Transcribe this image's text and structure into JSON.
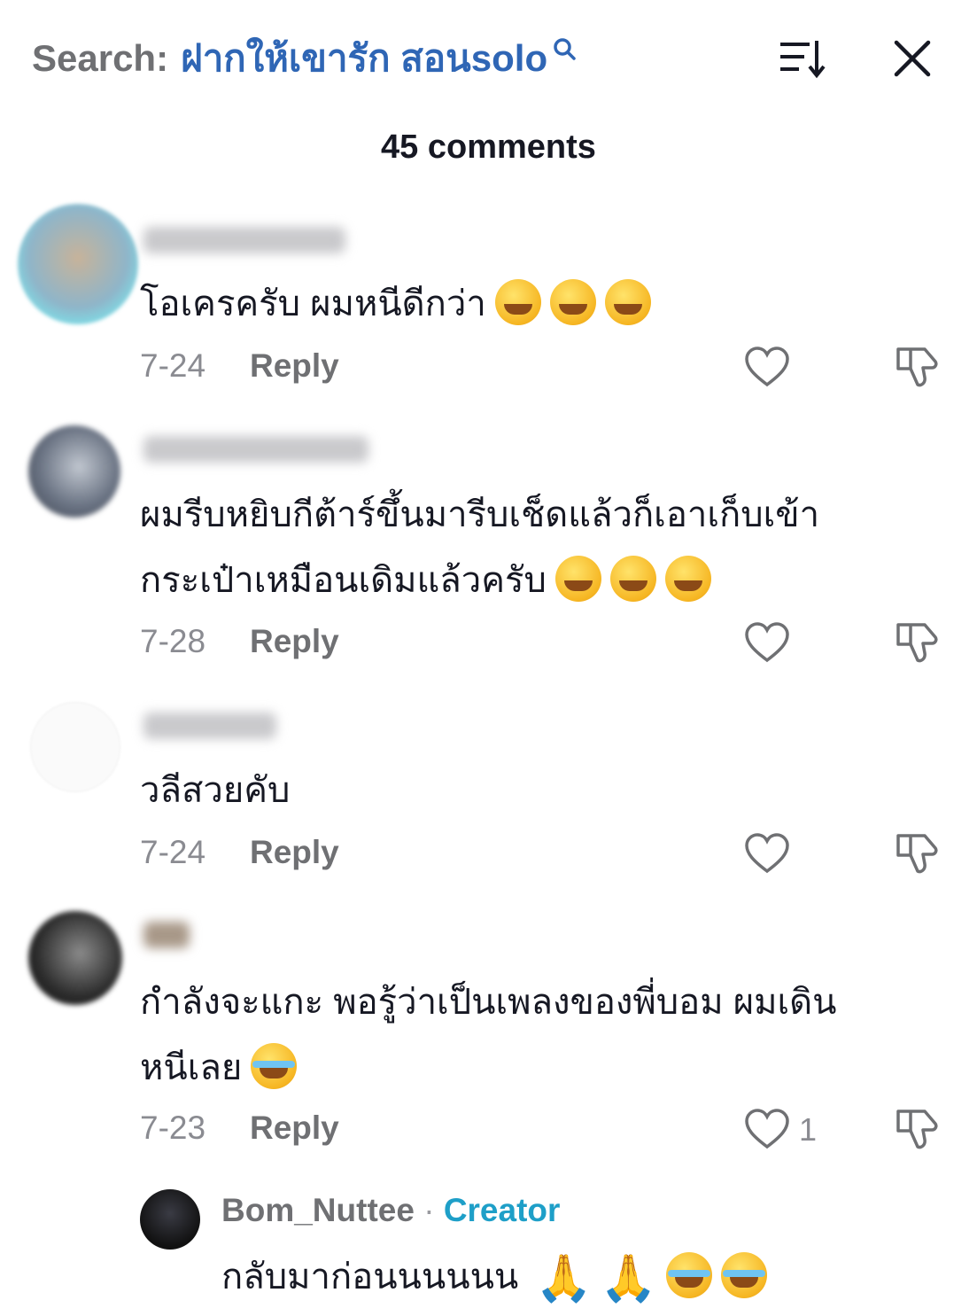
{
  "header": {
    "search_prefix": "Search:",
    "search_query": "ฝากให้เขารัก สอนsolo",
    "comment_count": "45 comments"
  },
  "comments": [
    {
      "text_line1": "โอเครครับ ผมหนีดีกว่า",
      "emojis": [
        "laughing-face",
        "laughing-face",
        "laughing-face"
      ],
      "date": "7-24",
      "reply_label": "Reply"
    },
    {
      "text_line1": "ผมรีบหยิบกีต้าร์ขึ้นมารีบเช็ดแล้วก็เอาเก็บเข้า",
      "text_line2": "กระเป๋าเหมือนเดิมแล้วครับ",
      "emojis": [
        "grinning-face",
        "grinning-face",
        "grinning-face"
      ],
      "date": "7-28",
      "reply_label": "Reply"
    },
    {
      "text_line1": "วลีสวยคับ",
      "date": "7-24",
      "reply_label": "Reply"
    },
    {
      "text_line1": "กำลังจะแกะ พอรู้ว่าเป็นเพลงของพี่บอม ผมเดิน",
      "text_line2": "หนีเลย",
      "emojis": [
        "tears-of-joy-face"
      ],
      "date": "7-23",
      "reply_label": "Reply",
      "like_count": "1"
    }
  ],
  "creator_reply": {
    "username": "Bom_Nuttee",
    "separator": "·",
    "badge": "Creator",
    "text": "กลับมาก่อนนนนนน",
    "emojis": [
      "folded-hands",
      "folded-hands",
      "tears-of-joy-face",
      "tears-of-joy-face"
    ]
  },
  "colors": {
    "query": "#2f66b5",
    "creator_badge": "#1e9fc8",
    "muted": "#6f7073"
  }
}
